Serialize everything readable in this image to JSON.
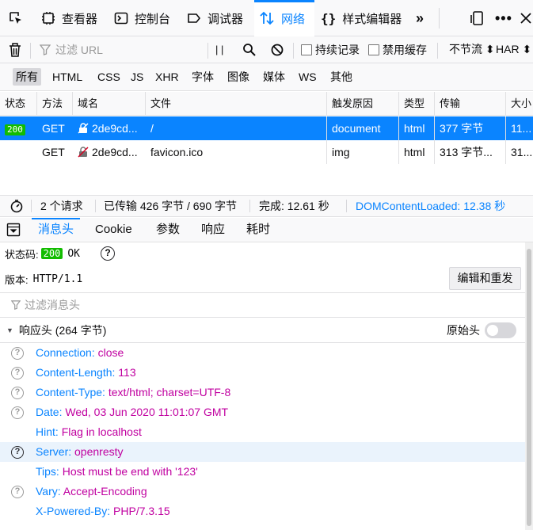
{
  "toolbar": {
    "tabs": [
      {
        "label": "查看器",
        "icon": "inspector-icon"
      },
      {
        "label": "控制台",
        "icon": "console-icon"
      },
      {
        "label": "调试器",
        "icon": "debugger-icon"
      },
      {
        "label": "网络",
        "icon": "network-icon"
      },
      {
        "label": "样式编辑器",
        "icon": "style-editor-icon"
      }
    ],
    "active_color": "#0a84ff"
  },
  "filterbar": {
    "filter_placeholder": "过滤 URL",
    "pause_label": "| |",
    "persist_logs_label": "持续记录",
    "disable_cache_label": "禁用缓存",
    "throttle_label": "不节流 ⬍",
    "har_label": "HAR ⬍"
  },
  "type_tabs": [
    "所有",
    "HTML",
    "CSS",
    "JS",
    "XHR",
    "字体",
    "图像",
    "媒体",
    "WS",
    "其他"
  ],
  "columns": [
    "状态",
    "方法",
    "域名",
    "文件",
    "触发原因",
    "类型",
    "传输",
    "大小"
  ],
  "requests": [
    {
      "status": "200",
      "method": "GET",
      "domain": "2de9cd...",
      "file": "/",
      "cause": "document",
      "type": "html",
      "transferred": "377 字节",
      "size": "11..."
    },
    {
      "status": "",
      "method": "GET",
      "domain": "2de9cd...",
      "file": "favicon.ico",
      "cause": "img",
      "type": "html",
      "transferred": "313 字节...",
      "size": "31..."
    }
  ],
  "summary": {
    "requests": "2 个请求",
    "transferred": "已传输 426 字节 / 690 字节",
    "finish": "完成: 12.61 秒",
    "dom_loaded": "DOMContentLoaded: 12.38 秒"
  },
  "detail_tabs": [
    "消息头",
    "Cookie",
    "参数",
    "响应",
    "耗时"
  ],
  "details": {
    "status_label": "状态码:",
    "status_code": "200",
    "status_text": "OK",
    "version_label": "版本:",
    "version_value": "HTTP/1.1",
    "edit_resend_label": "编辑和重发",
    "filter_headers_placeholder": "过滤消息头",
    "response_headers_label": "响应头 (264 字节)",
    "raw_headers_label": "原始头"
  },
  "response_headers": [
    {
      "name": "Connection:",
      "value": "close",
      "icon": true,
      "dark": false,
      "highlight": false
    },
    {
      "name": "Content-Length:",
      "value": "113",
      "icon": true,
      "dark": false,
      "highlight": false
    },
    {
      "name": "Content-Type:",
      "value": "text/html; charset=UTF-8",
      "icon": true,
      "dark": false,
      "highlight": false
    },
    {
      "name": "Date:",
      "value": "Wed, 03 Jun 2020 11:01:07 GMT",
      "icon": true,
      "dark": false,
      "highlight": false
    },
    {
      "name": "Hint:",
      "value": "Flag in localhost",
      "icon": false,
      "dark": false,
      "highlight": false
    },
    {
      "name": "Server:",
      "value": "openresty",
      "icon": true,
      "dark": true,
      "highlight": true
    },
    {
      "name": "Tips:",
      "value": "Host must be end with '123'",
      "icon": false,
      "dark": false,
      "highlight": false
    },
    {
      "name": "Vary:",
      "value": "Accept-Encoding",
      "icon": true,
      "dark": false,
      "highlight": false
    },
    {
      "name": "X-Powered-By:",
      "value": "PHP/7.3.15",
      "icon": false,
      "dark": false,
      "highlight": false
    }
  ]
}
